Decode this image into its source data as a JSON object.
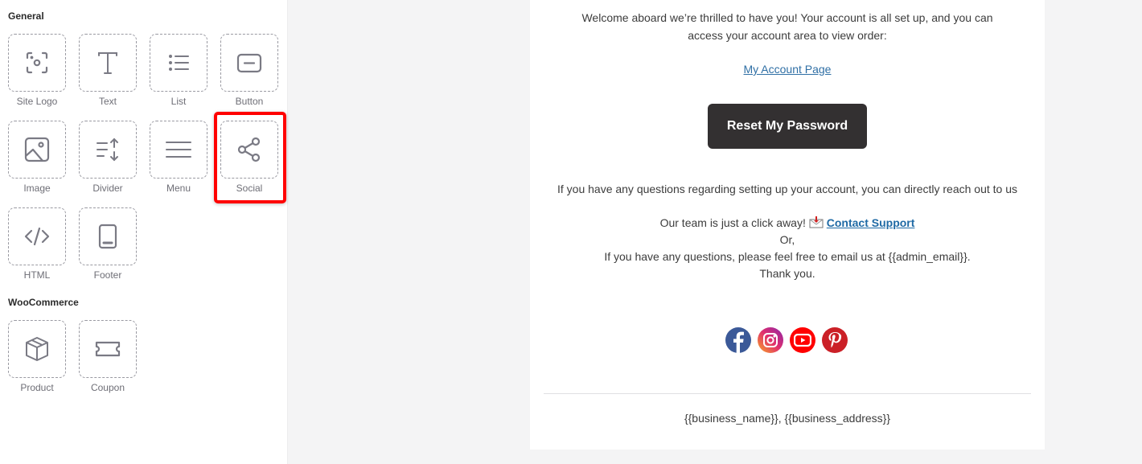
{
  "sidebar": {
    "sections": [
      {
        "title": "General"
      },
      {
        "title": "WooCommerce"
      }
    ],
    "blocks": [
      {
        "label": "Site Logo",
        "icon": "site-logo-icon"
      },
      {
        "label": "Text",
        "icon": "text-icon"
      },
      {
        "label": "List",
        "icon": "list-icon"
      },
      {
        "label": "Button",
        "icon": "button-icon"
      },
      {
        "label": "Image",
        "icon": "image-icon"
      },
      {
        "label": "Divider",
        "icon": "divider-icon"
      },
      {
        "label": "Menu",
        "icon": "menu-icon"
      },
      {
        "label": "Social",
        "icon": "share-icon"
      },
      {
        "label": "HTML",
        "icon": "code-icon"
      },
      {
        "label": "Footer",
        "icon": "footer-icon"
      },
      {
        "label": "Product",
        "icon": "box-icon"
      },
      {
        "label": "Coupon",
        "icon": "ticket-icon"
      }
    ],
    "highlighted_block": "Social"
  },
  "email": {
    "welcome_line1": "Welcome aboard we’re thrilled to have you! Your account is all set up, and you can",
    "welcome_line2": "access your account area to view order:",
    "account_link": "My Account Page",
    "reset_button": "Reset My Password",
    "questions_text": "If you have any questions regarding setting up your account, you can directly reach out to us",
    "team_text": "Our team is just a click away!",
    "contact_link": "Contact Support",
    "or_text": "Or,",
    "email_text": "If you have any questions, please feel free to email us at {{admin_email}}.",
    "thanks_text": "Thank you.",
    "social_icons": [
      {
        "name": "facebook",
        "color": "#3b5998"
      },
      {
        "name": "instagram",
        "color": "#e1306c"
      },
      {
        "name": "youtube",
        "color": "#ff0000"
      },
      {
        "name": "pinterest",
        "color": "#cb2027"
      }
    ],
    "footer_text": "{{business_name}}, {{business_address}}"
  },
  "colors": {
    "highlight": "#ff0000",
    "button_bg": "#333031",
    "link": "#2f6fa5"
  }
}
